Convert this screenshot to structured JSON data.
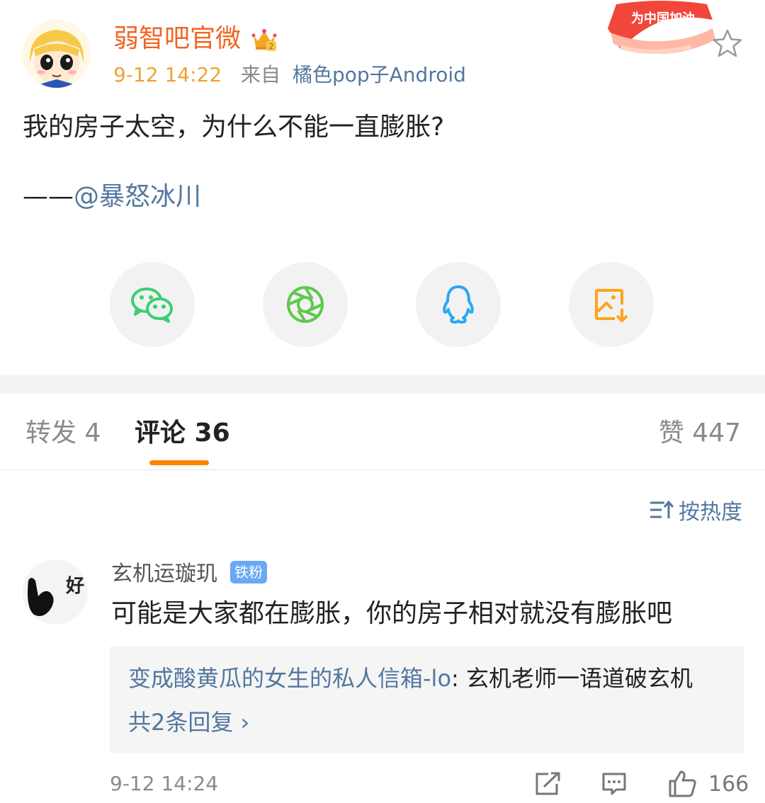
{
  "post": {
    "author": "弱智吧官微",
    "time": "9-12 14:22",
    "from_label": "来自",
    "source": "橘色pop子Android",
    "promo_badge": "为中国加油",
    "text": "我的房子太空，为什么不能一直膨胀?",
    "mention_prefix": "——",
    "mention": "@暴怒冰川"
  },
  "share_icons": [
    "wechat-icon",
    "moments-icon",
    "qq-icon",
    "save-image-icon"
  ],
  "tabs": {
    "repost": "转发 4",
    "comments": "评论 36",
    "likes": "赞 447"
  },
  "sort_label": "按热度",
  "comment": {
    "avatar_text": "好",
    "name": "玄机运璇玑",
    "badge": "铁粉",
    "text": "可能是大家都在膨胀，你的房子相对就没有膨胀吧",
    "reply_user": "变成酸黄瓜的女生的私人信箱-lo",
    "reply_text": ": 玄机老师一语道破玄机",
    "reply_more": "共2条回复 ›",
    "time": "9-12 14:24",
    "like_count": "166"
  },
  "colors": {
    "accent": "#ff8200",
    "author": "#f26522",
    "link": "#53779f",
    "wechat": "#3ccf73",
    "moments": "#5ec84d",
    "qq": "#2aa7f5",
    "save": "#ffa319"
  }
}
